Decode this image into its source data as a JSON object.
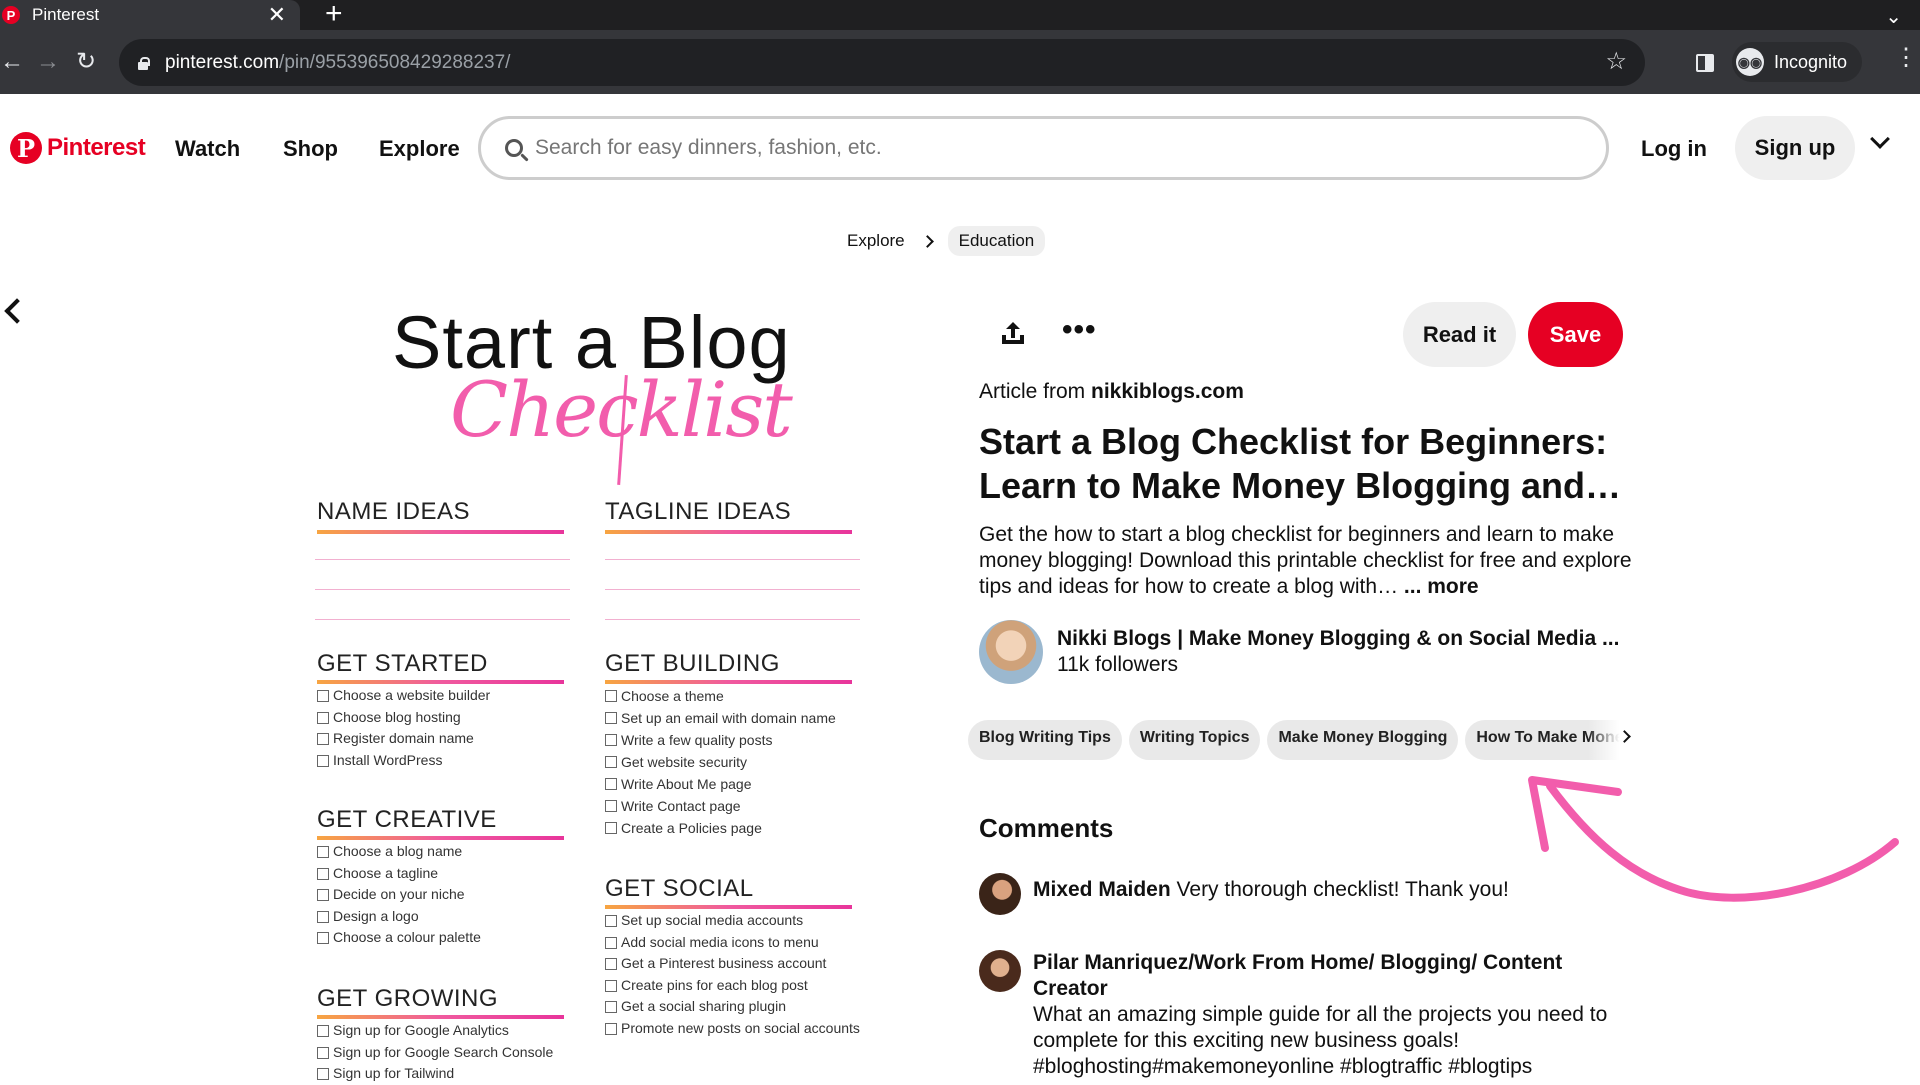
{
  "browser": {
    "tab_title": "Pinterest",
    "tab_close": "✕",
    "new_tab": "+",
    "url_host": "pinterest.com",
    "url_path": "/pin/955396508429288237/",
    "profile_label": "Incognito"
  },
  "header": {
    "logo_text": "Pinterest",
    "logo_mark": "P",
    "nav": [
      "Watch",
      "Shop",
      "Explore"
    ],
    "search_placeholder": "Search for easy dinners, fashion, etc.",
    "login_label": "Log in",
    "signup_label": "Sign up"
  },
  "breadcrumb": {
    "items": [
      "Explore",
      "Education"
    ]
  },
  "pin_image": {
    "title": "Start a Blog",
    "script": "Checklist",
    "sections": [
      {
        "heading": "NAME IDEAS",
        "items": []
      },
      {
        "heading": "TAGLINE IDEAS",
        "items": []
      },
      {
        "heading": "GET STARTED",
        "items": [
          "Choose a website builder",
          "Choose blog hosting",
          "Register domain name",
          "Install WordPress"
        ]
      },
      {
        "heading": "GET BUILDING",
        "items": [
          "Choose a theme",
          "Set up an email with domain name",
          "Write a few quality posts",
          "Get website security",
          "Write About Me page",
          "Write Contact page",
          "Create a Policies page"
        ]
      },
      {
        "heading": "GET CREATIVE",
        "items": [
          "Choose a blog name",
          "Choose a tagline",
          "Decide on your niche",
          "Design a logo",
          "Choose a colour palette"
        ]
      },
      {
        "heading": "GET SOCIAL",
        "items": [
          "Set up social media accounts",
          "Add social media icons to menu",
          "Get a Pinterest business account",
          "Create pins for each blog post",
          "Get a social sharing plugin",
          "Promote new posts on social accounts"
        ]
      },
      {
        "heading": "GET GROWING",
        "items": [
          "Sign up for Google Analytics",
          "Sign up for Google Search Console",
          "Sign up for Tailwind"
        ]
      }
    ]
  },
  "pin": {
    "more_dots": "•••",
    "read_it_label": "Read it",
    "save_label": "Save",
    "source_prefix": "Article from ",
    "source_domain": "nikkiblogs.com",
    "title": "Start a Blog Checklist for Beginners: Learn to Make Money Blogging and…",
    "description": "Get the how to start a blog checklist for beginners and learn to make money blogging! Download this printable checklist for free and explore tips and ideas for how to create a blog with…",
    "more_label": "... more",
    "author_name": "Nikki Blogs | Make Money Blogging & on Social Media ...",
    "author_followers": "11k followers",
    "tags": [
      "Blog Writing Tips",
      "Writing Topics",
      "Make Money Blogging",
      "How To Make Money"
    ]
  },
  "comments": {
    "heading": "Comments",
    "items": [
      {
        "author": "Mixed Maiden",
        "text": " Very thorough checklist! Thank you!"
      },
      {
        "author": "Pilar Manriquez/Work From Home/ Blogging/ Content Creator",
        "text": "What an amazing simple guide for all the projects you need to complete for this exciting new business goals! #bloghosting#makemoneyonline #blogtraffic #blogtips"
      }
    ]
  },
  "colors": {
    "brand": "#e60023",
    "annotation_arrow": "#f25dac"
  }
}
